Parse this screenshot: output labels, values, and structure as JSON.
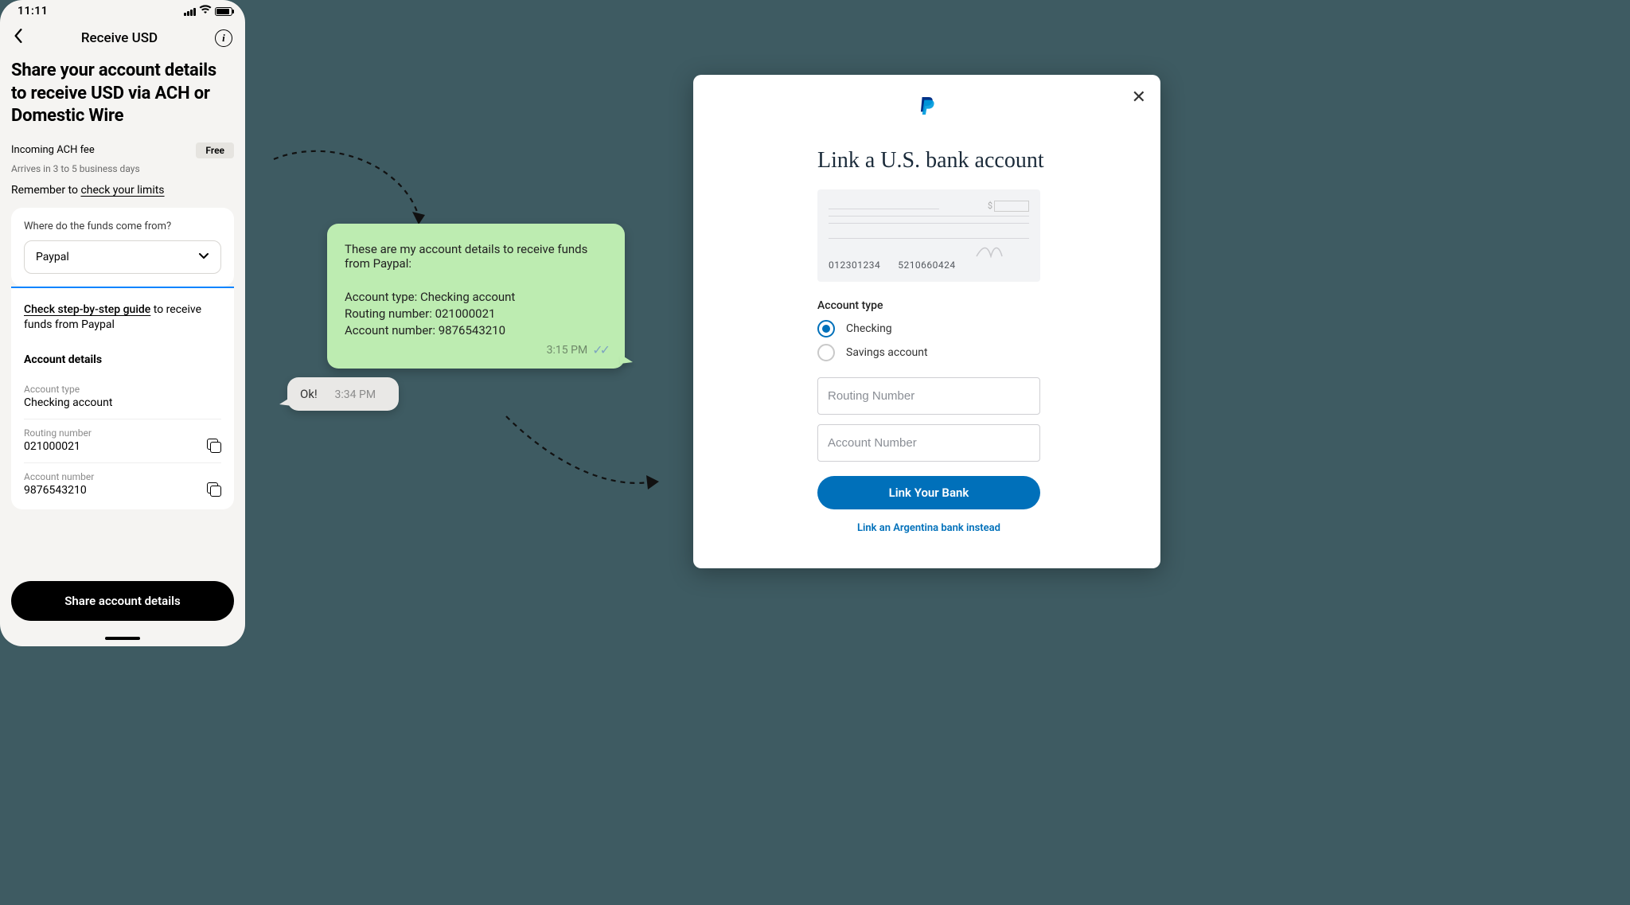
{
  "phone": {
    "time": "11:11",
    "nav_title": "Receive USD",
    "h1": "Share your account details to receive USD via ACH or Domestic Wire",
    "fee_label": "Incoming ACH fee",
    "fee_value": "Free",
    "arrival": "Arrives in 3 to 5 business days",
    "limits_prefix": "Remember to ",
    "limits_link": "check your limits",
    "source_q": "Where do the funds come from?",
    "source_value": "Paypal",
    "guide_link": "Check step-by-step guide",
    "guide_suffix": " to receive funds from Paypal",
    "details_title": "Account details",
    "acct_type_label": "Account type",
    "acct_type_value": "Checking account",
    "routing_label": "Routing number",
    "routing_value": "021000021",
    "acctnum_label": "Account number",
    "acctnum_value": "9876543210",
    "share_btn": "Share account details"
  },
  "chat": {
    "msg_intro": "These are my account details to receive funds from Paypal:",
    "msg_l1": "Account type: Checking account",
    "msg_l2": "Routing number: 021000021",
    "msg_l3": "Account number: 9876543210",
    "msg_time": "3:15 PM",
    "reply_text": "Ok!",
    "reply_time": "3:34 PM"
  },
  "paypal": {
    "title": "Link a U.S. bank account",
    "check_num1": "012301234",
    "check_num2": "5210660424",
    "account_type_label": "Account type",
    "opt_checking": "Checking",
    "opt_savings": "Savings account",
    "routing_ph": "Routing Number",
    "account_ph": "Account Number",
    "cta": "Link Your Bank",
    "alt_link": "Link an Argentina bank instead"
  }
}
